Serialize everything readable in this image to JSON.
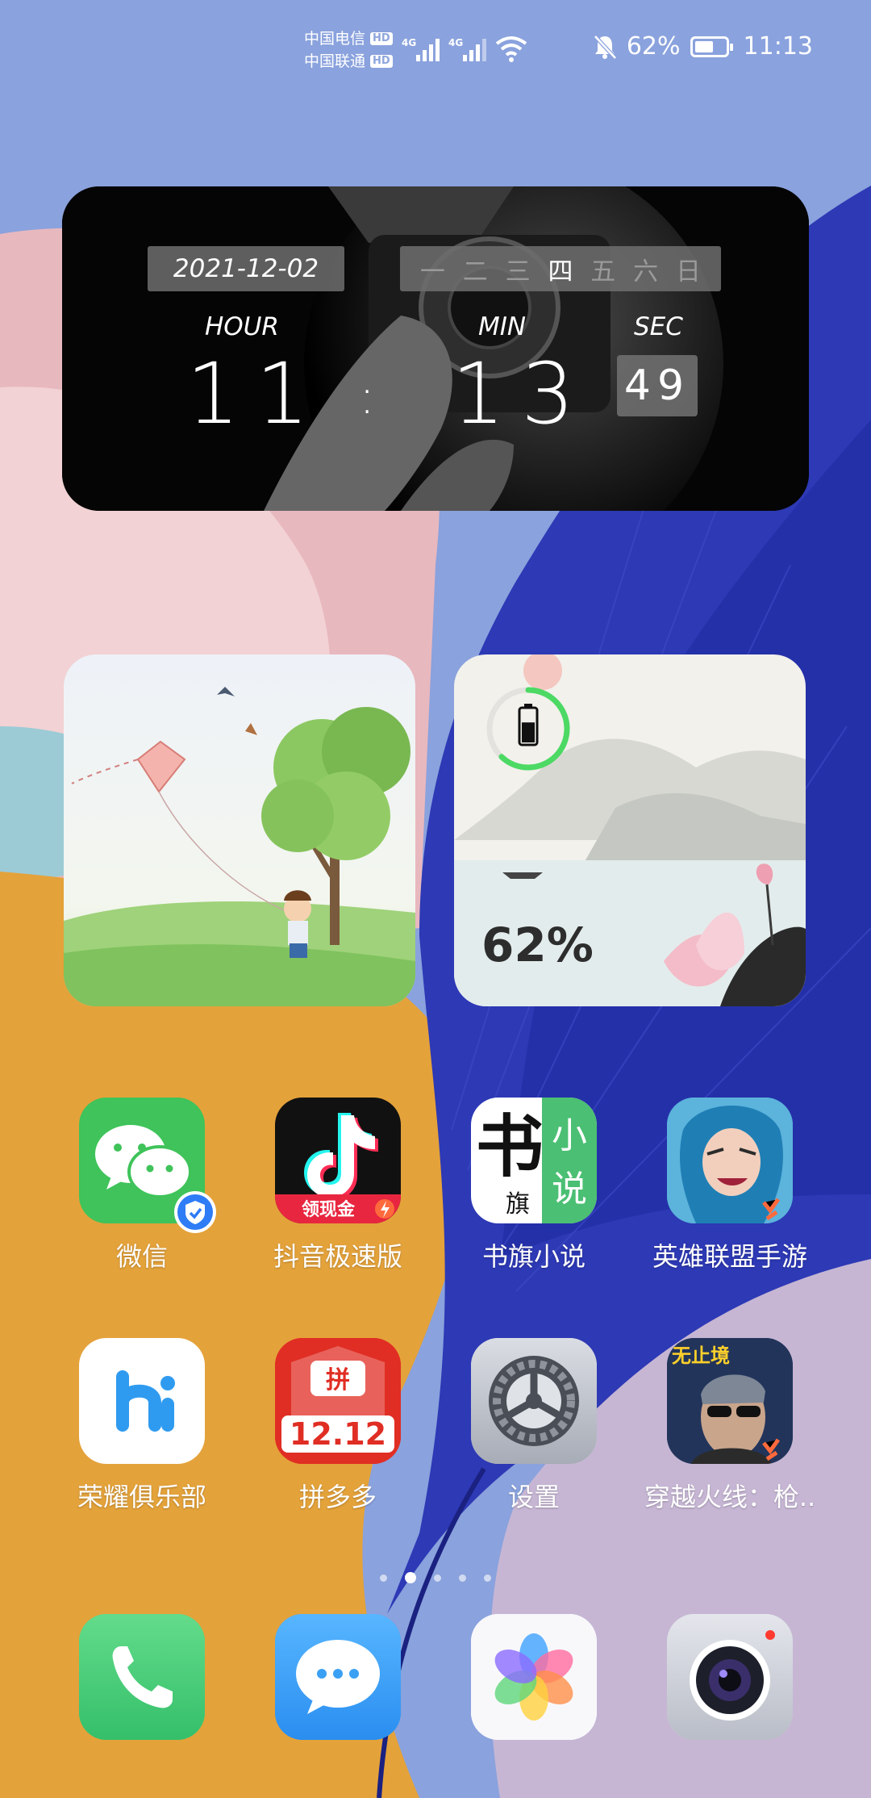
{
  "status_bar": {
    "carrier_1": "中国电信",
    "carrier_2": "中国联通",
    "hd_label": "HD",
    "network_1": "4G",
    "network_2": "4G",
    "battery_percent": "62%",
    "battery_level": 0.62,
    "time": "11:13",
    "icons": [
      "signal-icon",
      "wifi-icon",
      "bell-muted-icon",
      "battery-icon"
    ]
  },
  "clock_widget": {
    "date": "2021-12-02",
    "weekdays": [
      "一",
      "二",
      "三",
      "四",
      "五",
      "六",
      "日"
    ],
    "current_weekday_index": 3,
    "hour_label": "HOUR",
    "min_label": "MIN",
    "sec_label": "SEC",
    "hour": "11",
    "separator": ":",
    "minute": "13",
    "second": "49"
  },
  "battery_widget": {
    "percent": "62%",
    "level": 0.62
  },
  "apps": [
    {
      "name": "微信",
      "icon": "wechat-icon"
    },
    {
      "name": "抖音极速版",
      "icon": "douyin-icon",
      "badge": "领现金"
    },
    {
      "name": "书旗小说",
      "icon": "shuqi-icon",
      "glyphs": [
        "书",
        "旗",
        "小",
        "说"
      ]
    },
    {
      "name": "英雄联盟手游",
      "icon": "lol-icon"
    },
    {
      "name": "荣耀俱乐部",
      "icon": "honor-club-icon"
    },
    {
      "name": "拼多多",
      "icon": "pinduoduo-icon",
      "glyph": "拼",
      "promo": "12.12"
    },
    {
      "name": "设置",
      "icon": "settings-icon"
    },
    {
      "name": "穿越火线：枪..",
      "icon": "crossfire-icon",
      "promo": "无止境"
    }
  ],
  "page_indicator": {
    "count": 5,
    "active": 1
  },
  "dock": [
    {
      "icon": "phone-icon"
    },
    {
      "icon": "messages-icon"
    },
    {
      "icon": "gallery-icon"
    },
    {
      "icon": "camera-icon"
    }
  ],
  "colors": {
    "wallpaper_blue": "#2f3cb8",
    "wallpaper_orange": "#e6a33a",
    "wallpaper_pink": "#e9b9c1",
    "battery_ring": "#4cd964",
    "wechat_green": "#3fc35a"
  }
}
